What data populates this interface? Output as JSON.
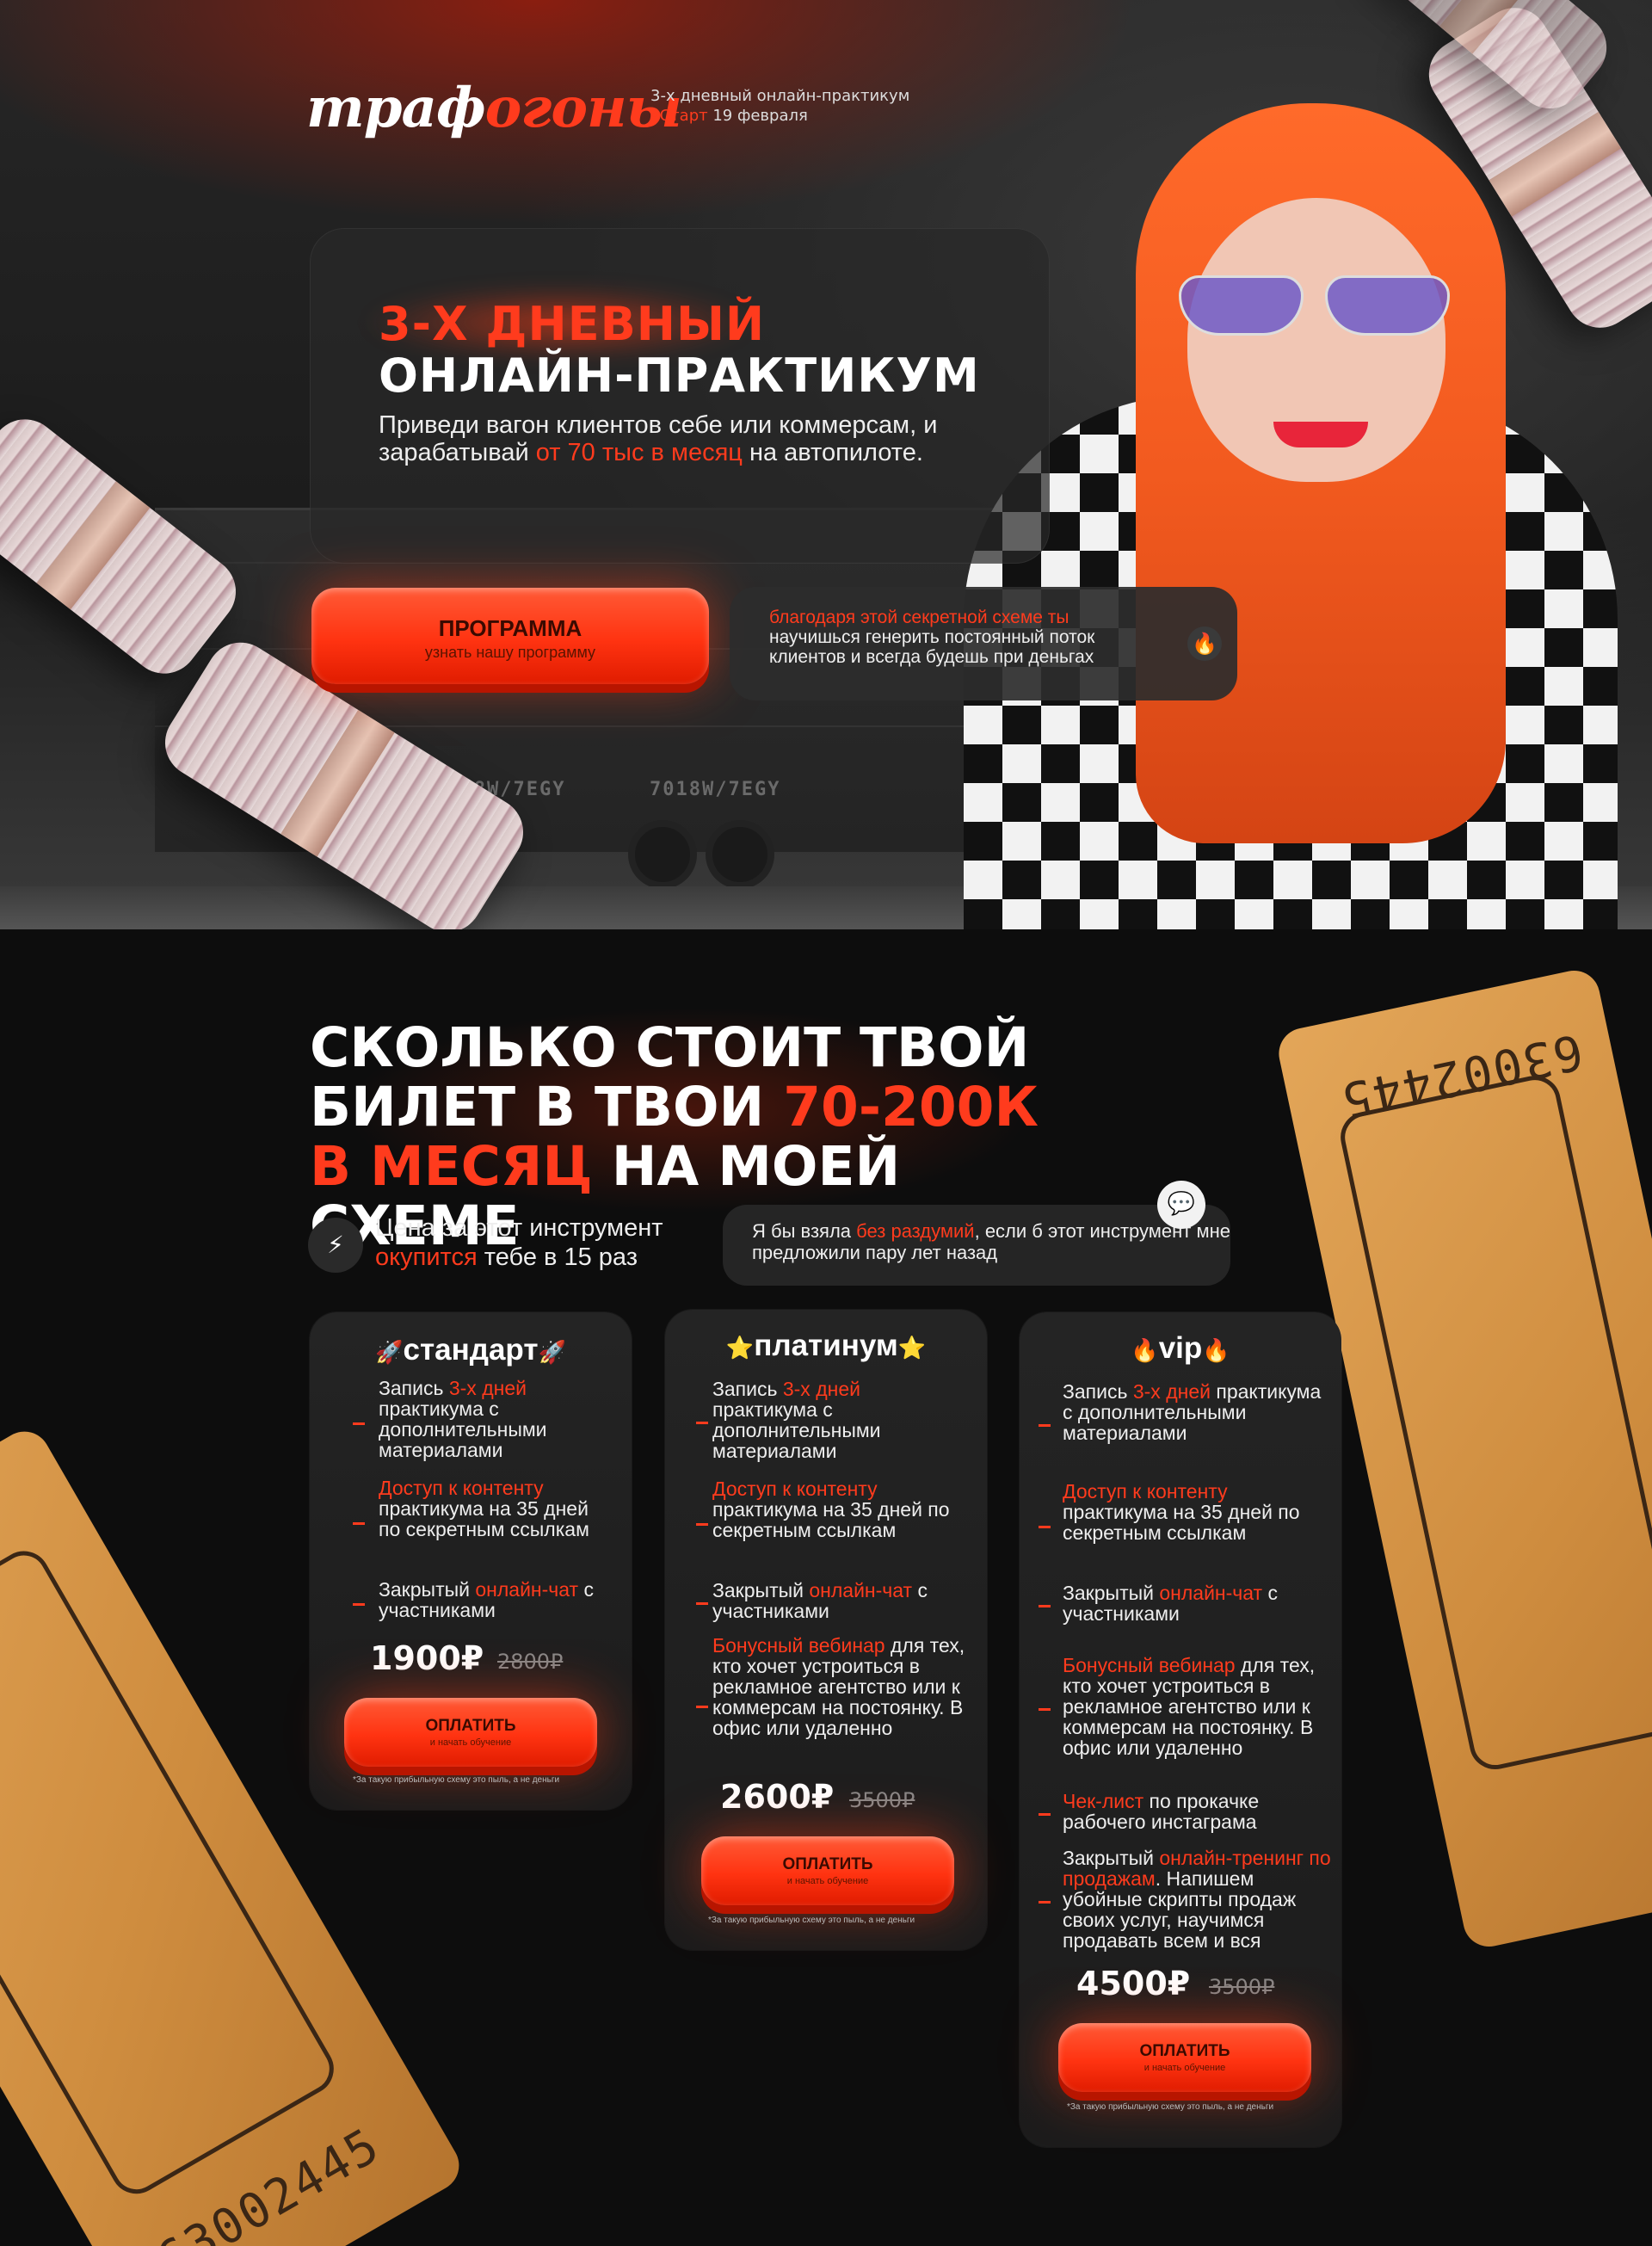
{
  "header": {
    "logo_part1": "траф",
    "logo_part2": "огоны",
    "meta_line1": "3-х дневный онлайн-практикум",
    "meta_start_label": "•Старт",
    "meta_start_date": " 19 февраля"
  },
  "hero": {
    "title_line1": "3-Х ДНЕВНЫЙ",
    "title_line2": "ОНЛАЙН-ПРАКТИКУМ",
    "subtitle_part1": "Приведи вагон клиентов себе или коммерсам, и зарабатывай ",
    "subtitle_highlight": "от 70 тыс в месяц",
    "subtitle_part2": " на автопилоте.",
    "button_title": "ПРОГРАММА",
    "button_subtitle": "узнать нашу программу",
    "callout_highlight": "благодаря этой секретной схеме ты",
    "callout_text": " научишься генерить постоянный поток клиентов и всегда будешь при деньгах",
    "callout_icon": "fire-icon",
    "callout_emoji": "🔥",
    "train_codes": [
      "7018W/7EGY",
      "7018W/7EGY"
    ]
  },
  "pricing_section": {
    "heading_part1": "СКОЛЬКО СТОИТ ТВОЙ БИЛЕТ  В ТВОИ ",
    "heading_highlight1": "70-200К В МЕСЯЦ",
    "heading_part2": " НА МОЕЙ СХЕМЕ",
    "payoff_icon": "lightning-icon",
    "payoff_emoji": "⚡",
    "payoff_part1": "Цена за этот инструмент ",
    "payoff_highlight": "окупится",
    "payoff_part2": " тебе в 15 раз",
    "quote_part1": "Я бы взяла ",
    "quote_highlight": "без раздумий",
    "quote_part2": ", если б этот инструмент мне предложили пару лет назад",
    "quote_icon": "chat-bubble-icon",
    "quote_emoji": "💬",
    "ticket_number": "63002445",
    "ticket_number_partial": "6",
    "ticket_number_partial2": "63"
  },
  "plans": [
    {
      "emoji": "🚀",
      "name": "стандарт",
      "features": [
        {
          "before": "Запись ",
          "hl": "3-х дней",
          "after": " практикума с дополнительными материалами"
        },
        {
          "before": "",
          "hl": "Доступ к контенту",
          "after": " практикума на 35 дней по секретным ссылкам"
        },
        {
          "before": "Закрытый ",
          "hl": "онлайн-чат",
          "after": " с участниками"
        }
      ],
      "price": "1900₽",
      "old_price": "2800₽",
      "button_title": "ОПЛАТИТЬ",
      "button_subtitle": "и начать обучение",
      "note": "*За такую прибыльную схему это пыль, а не деньги"
    },
    {
      "emoji": "⭐",
      "name": "платинум",
      "features": [
        {
          "before": "Запись ",
          "hl": "3-х дней",
          "after": " практикума с дополнительными материалами"
        },
        {
          "before": "",
          "hl": "Доступ к контенту",
          "after": " практикума на 35 дней по секретным ссылкам"
        },
        {
          "before": "Закрытый ",
          "hl": "онлайн-чат",
          "after": " с участниками"
        },
        {
          "before": "",
          "hl": "Бонусный вебинар",
          "after": " для тех, кто хочет устроиться в рекламное агентство или к коммерсам на постоянку. В офис или удаленно"
        }
      ],
      "price": "2600₽",
      "old_price": "3500₽",
      "button_title": "ОПЛАТИТЬ",
      "button_subtitle": "и начать обучение",
      "note": "*За такую прибыльную схему это пыль, а не деньги"
    },
    {
      "emoji": "🔥",
      "name": "vip",
      "features": [
        {
          "before": "Запись ",
          "hl": "3-х дней",
          "after": " практикума с дополнительными материалами"
        },
        {
          "before": "",
          "hl": "Доступ к контенту",
          "after": " практикума на 35 дней по секретным ссылкам"
        },
        {
          "before": "Закрытый ",
          "hl": "онлайн-чат",
          "after": " с участниками"
        },
        {
          "before": "",
          "hl": "Бонусный вебинар",
          "after": " для тех, кто хочет устроиться в рекламное агентство или к коммерсам на постоянку. В офис или удаленно"
        },
        {
          "before": "",
          "hl": "Чек-лист",
          "after": " по прокачке рабочего инстаграма"
        },
        {
          "before": "Закрытый ",
          "hl": "онлайн-тренинг по продажам",
          "after": ". Напишем убойные скрипты продаж своих услуг, научимся продавать всем и вся"
        }
      ],
      "price": "4500₽",
      "old_price": "3500₽",
      "button_title": "ОПЛАТИТЬ",
      "button_subtitle": "и начать обучение",
      "note": "*За такую прибыльную схему это пыль, а не деньги"
    }
  ],
  "colors": {
    "accent": "#ff3b1d",
    "background": "#0d0d0d",
    "card": "#222222",
    "ticket": "#d9984a"
  }
}
